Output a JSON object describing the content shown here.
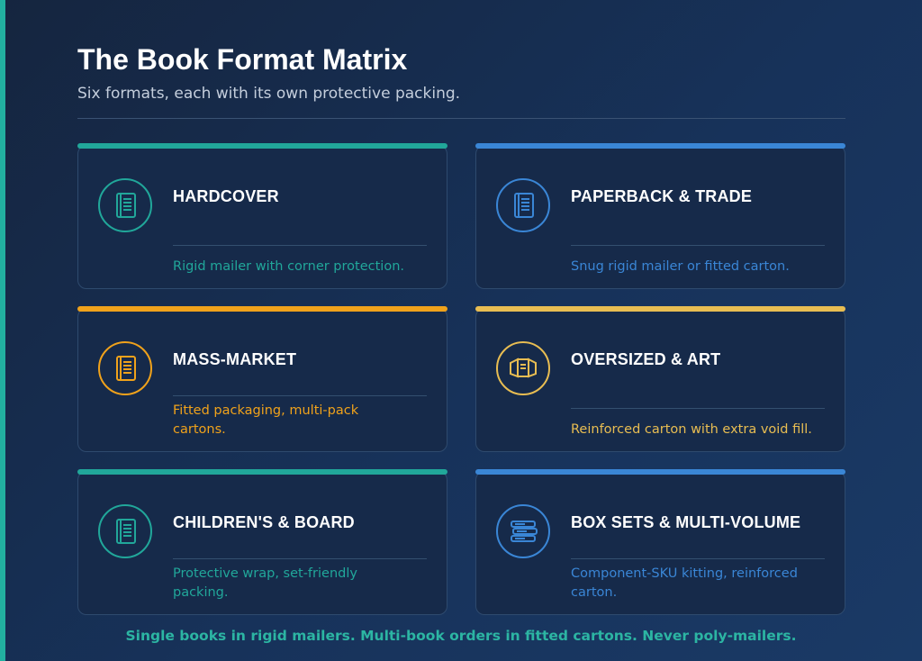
{
  "header": {
    "title": "The Book Format Matrix",
    "subtitle": "Six formats, each with its own protective packing."
  },
  "cards": [
    {
      "title": "HARDCOVER",
      "description": "Rigid mailer with corner protection.",
      "color": "#21a79a",
      "icon": "book-icon"
    },
    {
      "title": "PAPERBACK & TRADE",
      "description": "Snug rigid mailer or fitted carton.",
      "color": "#3a86d6",
      "icon": "book-icon"
    },
    {
      "title": "MASS-MARKET",
      "description": "Fitted packaging, multi-pack cartons.",
      "color": "#f0a21b",
      "icon": "book-icon"
    },
    {
      "title": "OVERSIZED & ART",
      "description": "Reinforced carton with extra void fill.",
      "color": "#e8bd52",
      "icon": "open-box-icon"
    },
    {
      "title": "CHILDREN'S & BOARD",
      "description": "Protective wrap, set-friendly packing.",
      "color": "#21a79a",
      "icon": "book-icon"
    },
    {
      "title": "BOX SETS & MULTI-VOLUME",
      "description": "Component-SKU kitting, reinforced carton.",
      "color": "#3a86d6",
      "icon": "book-stack-icon"
    }
  ],
  "footer": {
    "text": "Single books in rigid mailers. Multi-book orders in fitted cartons. Never poly-mailers."
  },
  "colors": {
    "background": "#15253f",
    "card_background": "#162a4a",
    "left_accent": "#22b0a0",
    "footer_text": "#2cb5a3"
  }
}
